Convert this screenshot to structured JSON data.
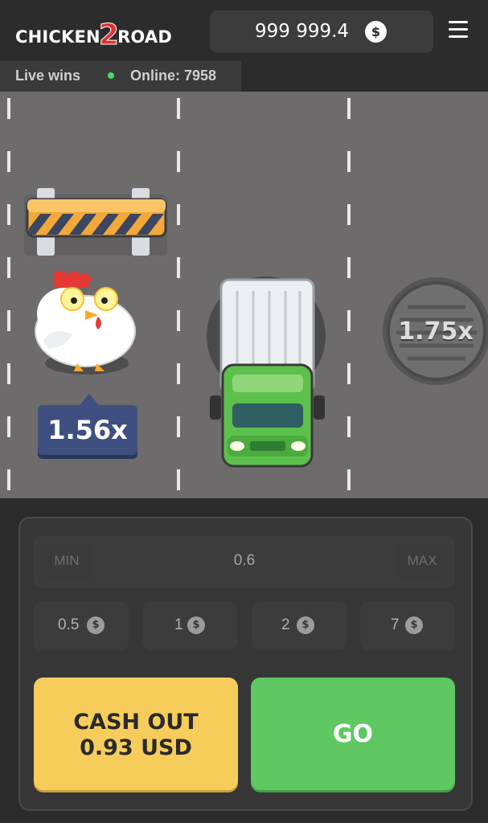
{
  "header": {
    "logo_part1": "CHICKEN",
    "logo_part2": "2",
    "logo_part3": "ROAD",
    "balance": "999 999.4",
    "currency_symbol": "$"
  },
  "subbar": {
    "live_wins": "Live wins",
    "online": "Online: 7958"
  },
  "road": {
    "current_multiplier": "1.56x",
    "next_multiplier": "1.75x"
  },
  "controls": {
    "min_label": "MIN",
    "max_label": "MAX",
    "bet_value": "0.6",
    "chips": [
      {
        "label": "0.5",
        "symbol": "$"
      },
      {
        "label": "1",
        "symbol": "$"
      },
      {
        "label": "2",
        "symbol": "$"
      },
      {
        "label": "7",
        "symbol": "$"
      }
    ],
    "cashout_line1": "CASH OUT",
    "cashout_line2": "0.93 USD",
    "go_label": "GO"
  },
  "colors": {
    "cashout": "#f6cd5b",
    "go": "#5fc863",
    "multiplier_tag": "#3f4f80",
    "online_dot": "#4cd964"
  }
}
